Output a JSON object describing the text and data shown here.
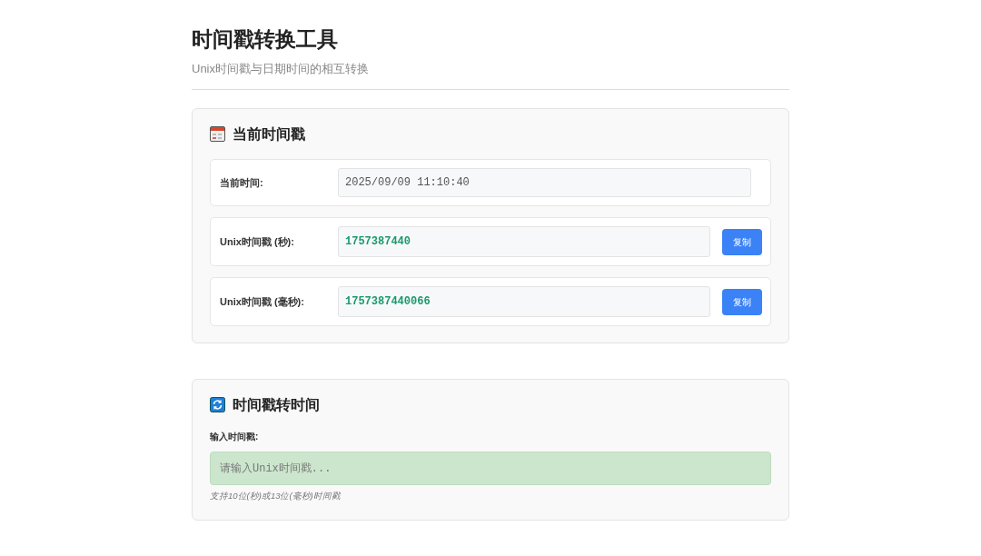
{
  "header": {
    "title": "时间戳转换工具",
    "subtitle": "Unix时间戳与日期时间的相互转换"
  },
  "current_section": {
    "title": "当前时间戳",
    "rows": [
      {
        "kind": "time",
        "label": "当前时间:",
        "value": "2025/09/09 11:10:40"
      },
      {
        "kind": "timestamp",
        "label": "Unix时间戳 (秒):",
        "value": "1757387440",
        "button": "复制"
      },
      {
        "kind": "timestamp",
        "label": "Unix时间戳 (毫秒):",
        "value": "1757387440066",
        "button": "复制"
      }
    ]
  },
  "convert_section": {
    "title": "时间戳转时间",
    "field_label": "输入时间戳:",
    "placeholder": "请输入Unix时间戳...",
    "hint": "支持10位(秒)或13位(毫秒)时间戳"
  }
}
